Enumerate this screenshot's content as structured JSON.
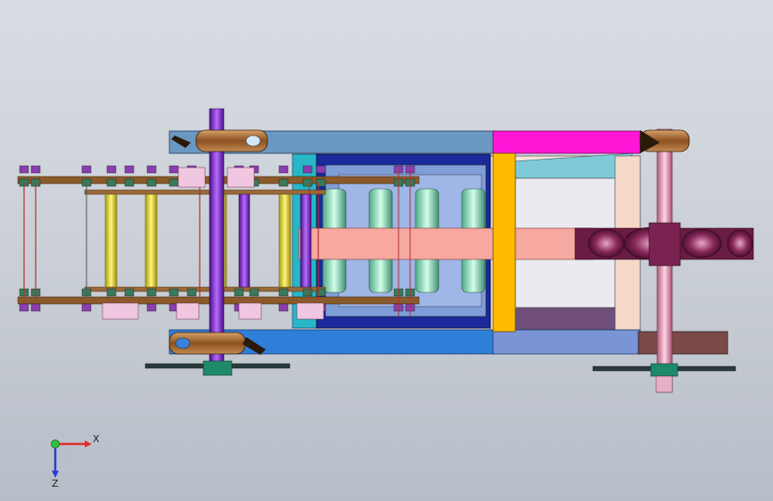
{
  "viewport": {
    "background_top": "#d9dde3",
    "background_bottom": "#b7bdc7"
  },
  "triad": {
    "x_label": "X",
    "z_label": "Z",
    "x_color": "#e0302a",
    "y_color": "#2ec23a",
    "z_color": "#2f3bd6"
  },
  "colors": {
    "frame_top_bar": "#5f8fb8",
    "frame_bottom_bar": "#2f7fd8",
    "end_plate": "#ffbb00",
    "magenta_block": "#ff17d7",
    "salmon_beam": "#f7a8a1",
    "roller_green": "#7ee0b4",
    "shaft_violet": "#7a21c9",
    "shaft_pink": "#f0a0c0",
    "clamp_bronze": "#a4662e",
    "chain_brown": "#8a5a2b",
    "chain_link": "#3a7a5a",
    "navy_panel": "#1a2a9a",
    "yellow_shaft": "#f2e73a",
    "plum_disc": "#7a2350",
    "dark_red_block": "#7a4a48",
    "cyan_panel": "#28b7c8"
  }
}
